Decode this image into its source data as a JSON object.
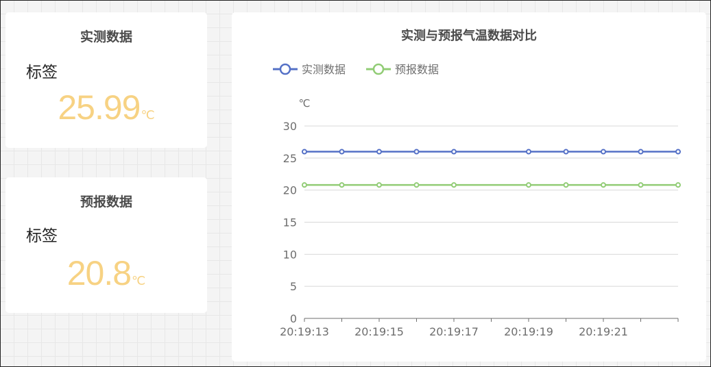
{
  "colors": {
    "accent_value": "#f7d283",
    "series_actual": "#5470c6",
    "series_forecast": "#91cc75"
  },
  "measured_card": {
    "title": "实测数据",
    "tag_label": "标签",
    "value": "25.99",
    "unit": "℃"
  },
  "forecast_card": {
    "title": "预报数据",
    "tag_label": "标签",
    "value": "20.8",
    "unit": "℃"
  },
  "chart_data": {
    "type": "line",
    "title": "实测与预报气温数据对比",
    "ylabel": "℃",
    "xlabel": "",
    "ylim": [
      0,
      30
    ],
    "y_ticks": [
      0,
      5,
      10,
      15,
      20,
      25,
      30
    ],
    "x_tick_labels": [
      "20:19:13",
      "20:19:15",
      "20:19:17",
      "20:19:19",
      "20:19:21"
    ],
    "x_range_seconds": [
      "20:19:13",
      "20:19:23"
    ],
    "x": [
      "20:19:13",
      "20:19:14",
      "20:19:15",
      "20:19:16",
      "20:19:17",
      "20:19:19",
      "20:19:20",
      "20:19:21",
      "20:19:22",
      "20:19:23"
    ],
    "series": [
      {
        "name": "实测数据",
        "color": "#5470c6",
        "values": [
          25.99,
          25.99,
          25.99,
          25.99,
          25.99,
          25.99,
          25.99,
          25.99,
          25.99,
          25.99
        ]
      },
      {
        "name": "预报数据",
        "color": "#91cc75",
        "values": [
          20.8,
          20.8,
          20.8,
          20.8,
          20.8,
          20.8,
          20.8,
          20.8,
          20.8,
          20.8
        ]
      }
    ],
    "grid": true,
    "legend_position": "top-left"
  }
}
